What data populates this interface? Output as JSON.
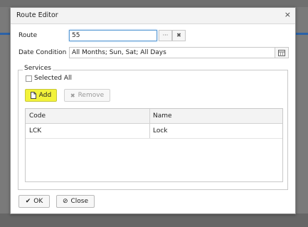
{
  "dialog": {
    "title": "Route Editor",
    "close_glyph": "×"
  },
  "form": {
    "route_label": "Route",
    "route_value": "55",
    "route_more_glyph": "···",
    "route_clear_glyph": "✖",
    "date_label": "Date Condition",
    "date_value": "All Months; Sun, Sat; All Days"
  },
  "services": {
    "legend": "Services",
    "select_all_label": "Selected All",
    "add_label": "Add",
    "remove_label": "Remove",
    "columns": [
      "Code",
      "Name"
    ],
    "rows": [
      {
        "code": "LCK",
        "name": "Lock"
      }
    ]
  },
  "footer": {
    "ok_label": "OK",
    "close_label": "Close"
  },
  "icons": {
    "add": "file-icon",
    "remove": "x-icon",
    "ok": "check-icon",
    "close": "ban-icon",
    "date_picker": "calendar-icon"
  },
  "colors": {
    "highlight": "#f2f23a",
    "focus_border": "#5b9bd5"
  }
}
